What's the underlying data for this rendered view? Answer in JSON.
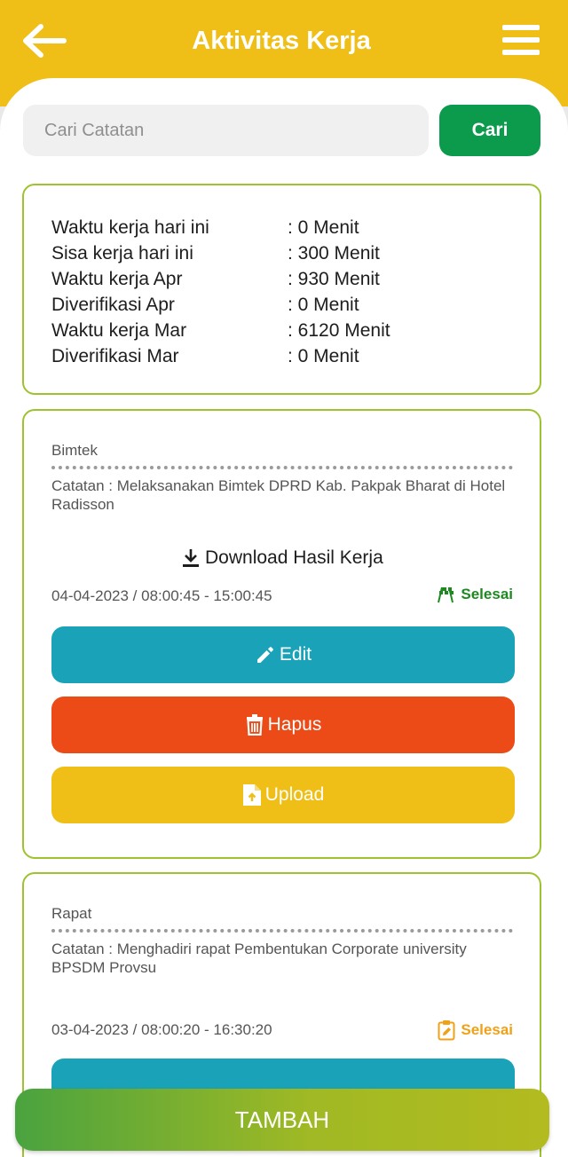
{
  "colors": {
    "header": "#efbf18",
    "primary_green": "#0c9a4c",
    "border_green": "#9fc32f",
    "edit": "#1aa3b8",
    "delete": "#ec4a16",
    "upload": "#efbf18",
    "status_done": "#1c8a1f",
    "status_pending": "#efa118"
  },
  "header": {
    "title": "Aktivitas Kerja",
    "back_icon": "arrow-left-icon",
    "menu_icon": "hamburger-menu-icon"
  },
  "search": {
    "placeholder": "Cari Catatan",
    "value": "",
    "button_label": "Cari"
  },
  "summary": {
    "rows": [
      {
        "label": "Waktu kerja hari ini",
        "value": ": 0 Menit"
      },
      {
        "label": "Sisa kerja hari ini",
        "value": ": 300 Menit"
      },
      {
        "label": "Waktu kerja Apr",
        "value": ": 930 Menit"
      },
      {
        "label": "Diverifikasi Apr",
        "value": ": 0 Menit"
      },
      {
        "label": "Waktu kerja Mar",
        "value": ": 6120 Menit"
      },
      {
        "label": "Diverifikasi Mar",
        "value": ": 0 Menit"
      }
    ]
  },
  "activities": [
    {
      "category": "Bimtek",
      "note": "Catatan : Melaksanakan Bimtek DPRD Kab. Pakpak Bharat di Hotel Radisson",
      "download_label": "Download Hasil Kerja",
      "datetime": "04-04-2023 / 08:00:45 - 15:00:45",
      "status": "Selesai",
      "status_icon": "checkered-flags-icon",
      "edit_label": "Edit",
      "delete_label": "Hapus",
      "upload_label": "Upload"
    },
    {
      "category": "Rapat",
      "note": "Catatan : Menghadiri rapat Pembentukan Corporate university BPSDM Provsu",
      "datetime": "03-04-2023 / 08:00:20 - 16:30:20",
      "status": "Selesai",
      "status_icon": "clipboard-edit-icon"
    }
  ],
  "footer": {
    "add_label": "TAMBAH"
  }
}
